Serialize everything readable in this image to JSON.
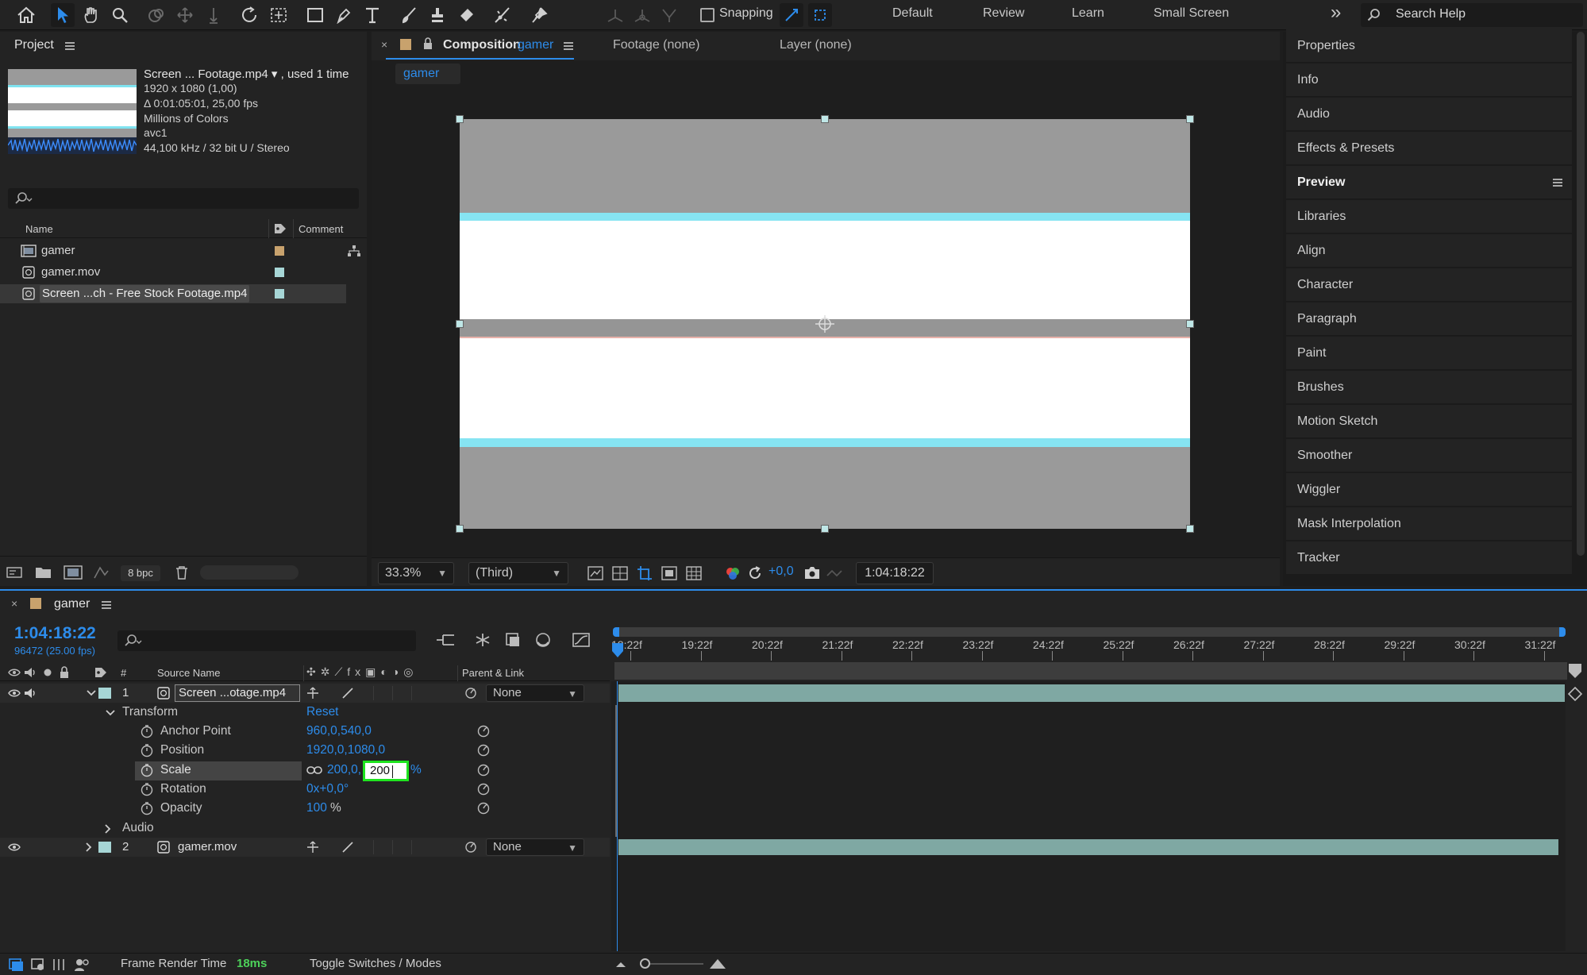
{
  "toolbar": {
    "snapping_label": "Snapping",
    "workspaces": [
      "Default",
      "Review",
      "Learn",
      "Small Screen"
    ],
    "overflow_label": "»",
    "search_placeholder": "Search Help"
  },
  "project": {
    "title": "Project",
    "footage_name": "Screen ... Footage.mp4 ▾ , used 1 time",
    "footage_size": "1920 x 1080 (1,00)",
    "footage_duration": "Δ 0:01:05:01, 25,00 fps",
    "footage_colors": "Millions of Colors",
    "footage_codec": "avc1",
    "footage_audio": "44,100 kHz / 32 bit U / Stereo",
    "col_name": "Name",
    "col_comment": "Comment",
    "items": [
      {
        "name": "gamer",
        "color": "#c8a26d"
      },
      {
        "name": "gamer.mov",
        "color": "#a7d6d6"
      },
      {
        "name": "Screen ...ch - Free Stock Footage.mp4",
        "color": "#a7d6d6"
      }
    ],
    "bpc": "8 bpc"
  },
  "composition": {
    "tab_label": "Composition",
    "tab_name": "gamer",
    "footage_tab": "Footage (none)",
    "layer_tab": "Layer (none)",
    "breadcrumb": "gamer",
    "zoom": "33.3%",
    "resolution": "(Third)",
    "exposure": "+0,0",
    "timecode": "1:04:18:22"
  },
  "right_panel": {
    "items": [
      "Properties",
      "Info",
      "Audio",
      "Effects & Presets",
      "Preview",
      "Libraries",
      "Align",
      "Character",
      "Paragraph",
      "Paint",
      "Brushes",
      "Motion Sketch",
      "Smoother",
      "Wiggler",
      "Mask Interpolation",
      "Tracker"
    ]
  },
  "timeline": {
    "title": "gamer",
    "timecode": "1:04:18:22",
    "frame_info": "96472 (25.00 fps)",
    "col_hash": "#",
    "col_source": "Source Name",
    "col_parent": "Parent & Link",
    "ruler_labels": [
      "18:22f",
      "19:22f",
      "20:22f",
      "21:22f",
      "22:22f",
      "23:22f",
      "24:22f",
      "25:22f",
      "26:22f",
      "27:22f",
      "28:22f",
      "29:22f",
      "30:22f",
      "31:22f"
    ],
    "layers": [
      {
        "num": "1",
        "name": "Screen ...otage.mp4",
        "parent": "None"
      },
      {
        "num": "2",
        "name": "gamer.mov",
        "parent": "None"
      }
    ],
    "transform_label": "Transform",
    "reset_label": "Reset",
    "props": [
      {
        "name": "Anchor Point",
        "value": "960,0,540,0"
      },
      {
        "name": "Position",
        "value": "1920,0,1080,0"
      },
      {
        "name": "Scale",
        "value": "200,0,",
        "edit": "200",
        "unit": "%"
      },
      {
        "name": "Rotation",
        "value": "0x+0,0°"
      },
      {
        "name": "Opacity",
        "value": "100",
        "unit": "%"
      }
    ],
    "audio_label": "Audio",
    "frame_render_label": "Frame Render Time",
    "frame_render_value": "18ms",
    "toggle_label": "Toggle Switches / Modes"
  }
}
